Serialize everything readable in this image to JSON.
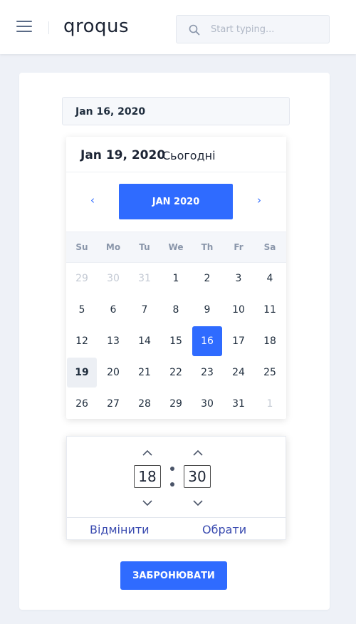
{
  "header": {
    "logo": "qroqus",
    "search_placeholder": "Start typing..."
  },
  "booking": {
    "date_value": "Jan 16, 2020",
    "book_label": "ЗАБРОНЮВАТИ"
  },
  "calendar": {
    "selected_date": "Jan 19, 2020",
    "today_label": "Сьогодні",
    "month_label": "JAN 2020",
    "prev_icon": "‹",
    "next_icon": "›",
    "weekdays": [
      "Su",
      "Mo",
      "Tu",
      "We",
      "Th",
      "Fr",
      "Sa"
    ],
    "weeks": [
      [
        "29",
        "30",
        "31",
        "1",
        "2",
        "3",
        "4"
      ],
      [
        "5",
        "6",
        "7",
        "8",
        "9",
        "10",
        "11"
      ],
      [
        "12",
        "13",
        "14",
        "15",
        "16",
        "17",
        "18"
      ],
      [
        "19",
        "20",
        "21",
        "22",
        "23",
        "24",
        "25"
      ],
      [
        "26",
        "27",
        "28",
        "29",
        "30",
        "31",
        "1"
      ]
    ],
    "muted_days": [
      "0-0",
      "0-1",
      "0-2",
      "4-6"
    ],
    "selected_day": "16",
    "today_day": "19"
  },
  "time": {
    "hours": "18",
    "minutes": "30",
    "cancel_label": "Відмінити",
    "choose_label": "Обрати"
  },
  "colors": {
    "accent": "#2f6bff",
    "link": "#3a4bb0"
  }
}
